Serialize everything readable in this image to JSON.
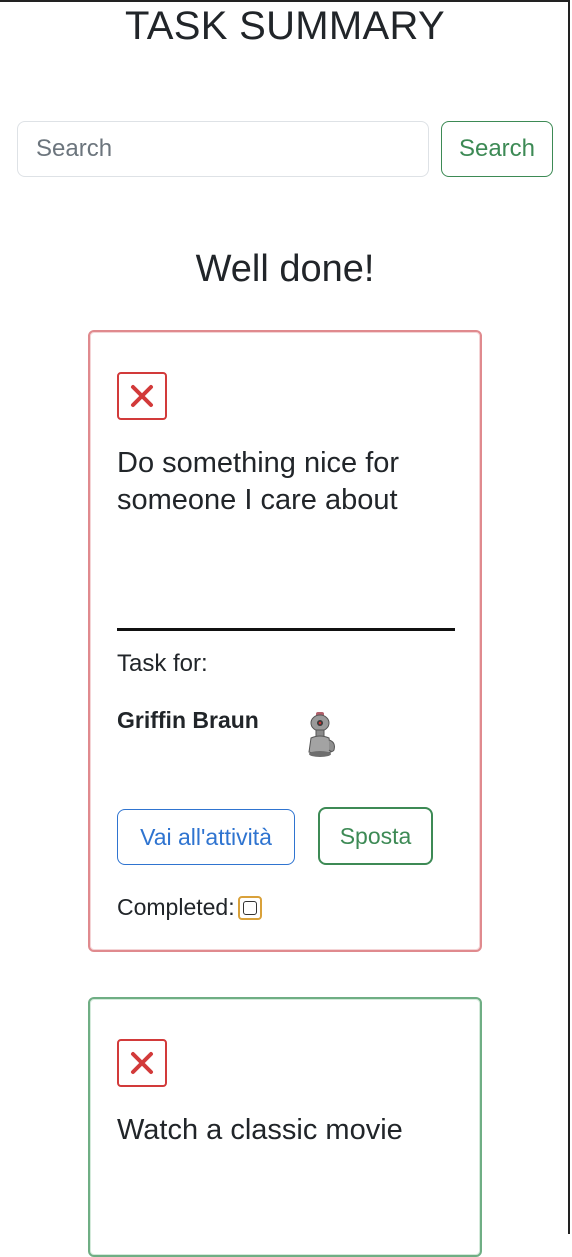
{
  "page": {
    "title": "TASK SUMMARY",
    "heading": "Well done!"
  },
  "search": {
    "placeholder": "Search",
    "value": "",
    "button_label": "Search"
  },
  "tasks": [
    {
      "title": "Do something nice for someone I care about",
      "task_for_label": "Task for:",
      "assignee": "Griffin Braun",
      "goto_label": "Vai all'attività",
      "move_label": "Sposta",
      "completed_label": "Completed:",
      "completed": false,
      "border_color": "#e08a8e"
    },
    {
      "title": "Watch a classic movie",
      "border_color": "#6fae84"
    }
  ],
  "colors": {
    "danger": "#d23a3a",
    "success": "#3d8a55",
    "primary": "#2f74d0",
    "warning": "#d9a13a"
  },
  "icons": {
    "delete": "close-icon",
    "avatar": "robot-avatar"
  }
}
